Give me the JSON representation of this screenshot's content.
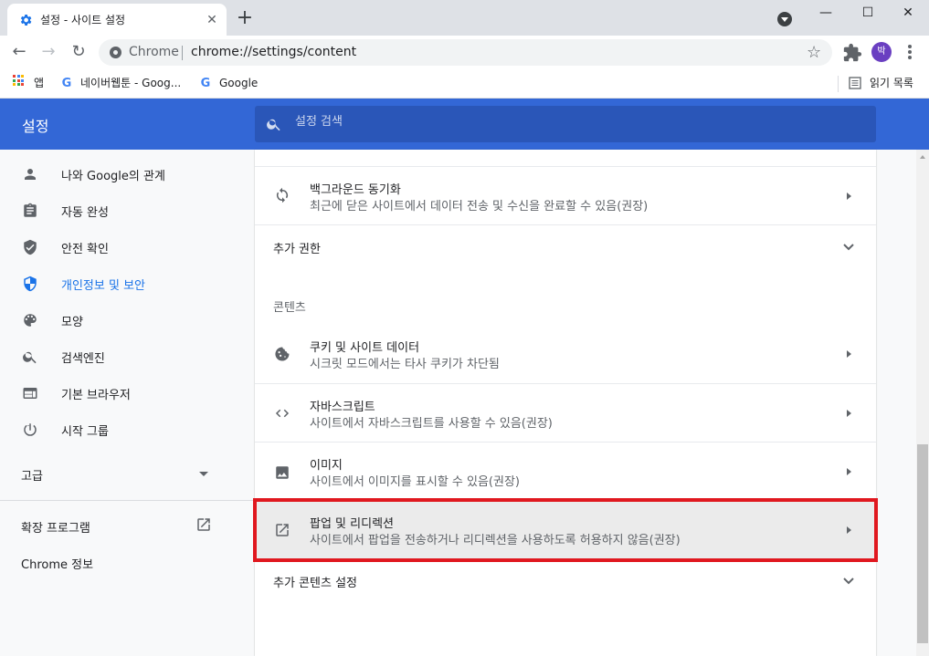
{
  "browser": {
    "tab_title": "설정 - 사이트 설정",
    "tab_close": "✕",
    "new_tab": "+",
    "window_controls": [
      "—",
      "☐",
      "✕"
    ],
    "omnibox_scheme": "Chrome",
    "omnibox_url": "chrome://settings/content",
    "profile_initial": "박",
    "bookmarks": [
      {
        "label": "앱",
        "icon": "apps-grid-icon"
      },
      {
        "label": "네이버웹툰 - Goog...",
        "icon": "google-g-icon"
      },
      {
        "label": "Google",
        "icon": "google-g-icon"
      }
    ],
    "reading_list": "읽기 목록"
  },
  "settings": {
    "title": "설정",
    "search_placeholder": "설정 검색"
  },
  "sidebar": {
    "items": [
      {
        "label": "나와 Google의 관계",
        "icon": "person-icon",
        "active": false
      },
      {
        "label": "자동 완성",
        "icon": "clipboard-icon",
        "active": false
      },
      {
        "label": "안전 확인",
        "icon": "shield-check-icon",
        "active": false
      },
      {
        "label": "개인정보 및 보안",
        "icon": "shield-icon",
        "active": true
      },
      {
        "label": "모양",
        "icon": "palette-icon",
        "active": false
      },
      {
        "label": "검색엔진",
        "icon": "search-icon",
        "active": false
      },
      {
        "label": "기본 브라우저",
        "icon": "browser-icon",
        "active": false
      },
      {
        "label": "시작 그룹",
        "icon": "power-icon",
        "active": false
      }
    ],
    "advanced": "고급",
    "extensions": "확장 프로그램",
    "about": "Chrome 정보"
  },
  "content": {
    "background_sync": {
      "title": "백그라운드 동기화",
      "desc": "최근에 닫은 사이트에서 데이터 전송 및 수신을 완료할 수 있음(권장)",
      "icon": "sync-icon"
    },
    "additional_permissions": "추가 권한",
    "section_content": "콘텐츠",
    "cookies": {
      "title": "쿠키 및 사이트 데이터",
      "desc": "시크릿 모드에서는 타사 쿠키가 차단됨",
      "icon": "cookie-icon"
    },
    "javascript": {
      "title": "자바스크립트",
      "desc": "사이트에서 자바스크립트를 사용할 수 있음(권장)",
      "icon": "code-icon"
    },
    "images": {
      "title": "이미지",
      "desc": "사이트에서 이미지를 표시할 수 있음(권장)",
      "icon": "image-icon"
    },
    "popups": {
      "title": "팝업 및 리디렉션",
      "desc": "사이트에서 팝업을 전송하거나 리디렉션을 사용하도록 허용하지 않음(권장)",
      "icon": "open-in-new-icon"
    },
    "additional_content": "추가 콘텐츠 설정"
  },
  "colors": {
    "header_blue": "#3367d6",
    "active_blue": "#1a73e8",
    "highlight_red": "#e0181f"
  }
}
